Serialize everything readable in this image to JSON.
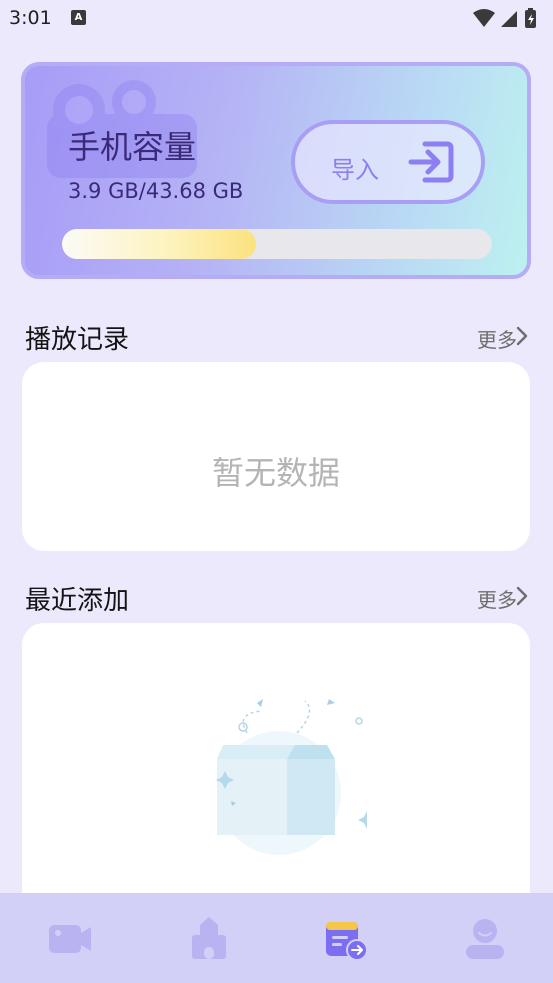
{
  "status_bar": {
    "time": "3:01",
    "notification_icon": "A"
  },
  "storage": {
    "title": "手机容量",
    "value": "3.9 GB/43.68 GB",
    "used_fraction": 0.45,
    "import_label": "导入"
  },
  "history": {
    "title": "播放记录",
    "more": "更多",
    "empty": "暂无数据"
  },
  "recent": {
    "title": "最近添加",
    "more": "更多"
  },
  "tabs": [
    {
      "icon": "video-camera-icon",
      "active": false
    },
    {
      "icon": "castle-icon",
      "active": false
    },
    {
      "icon": "calendar-icon",
      "active": true
    },
    {
      "icon": "user-icon",
      "active": false
    }
  ],
  "colors": {
    "accent": "#8b7ff1",
    "tab_inactive": "#b9b3f2",
    "tab_active": "#7c6ef0"
  }
}
